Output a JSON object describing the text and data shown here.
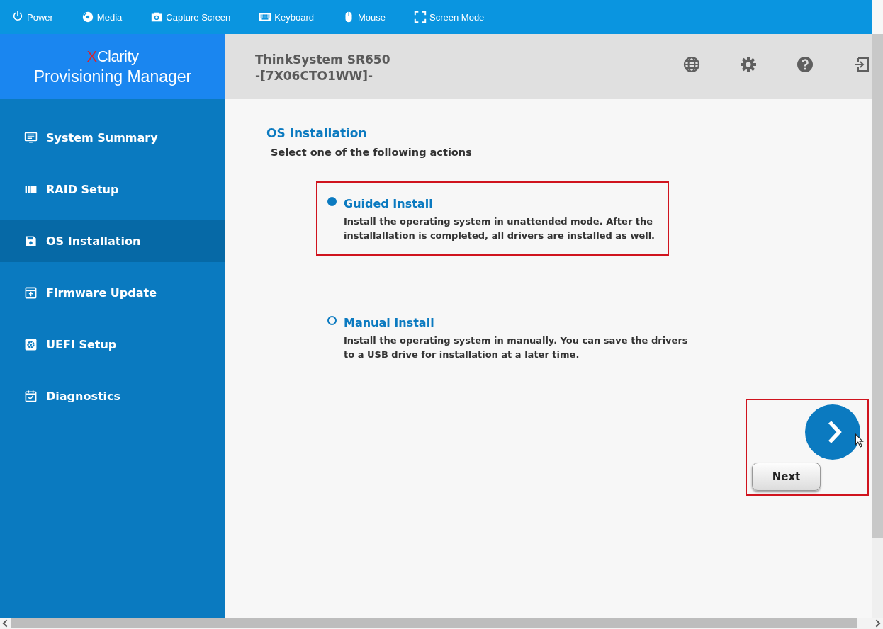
{
  "toolbar": [
    {
      "kind": "power",
      "label": "Power"
    },
    {
      "kind": "media",
      "label": "Media"
    },
    {
      "kind": "camera",
      "label": "Capture Screen"
    },
    {
      "kind": "keyboard",
      "label": "Keyboard"
    },
    {
      "kind": "mouse",
      "label": "Mouse"
    },
    {
      "kind": "screen",
      "label": "Screen Mode"
    }
  ],
  "logo": {
    "mark": "X",
    "name": "Clarity",
    "product": "Provisioning Manager"
  },
  "header": {
    "title_line_1": "ThinkSystem SR650",
    "title_line_2": "-[7X06CTO1WW]-",
    "icons": [
      {
        "kind": "globe"
      },
      {
        "kind": "settings"
      },
      {
        "kind": "help"
      },
      {
        "kind": "exit"
      }
    ]
  },
  "sidebar": {
    "items": [
      {
        "kind": "summary",
        "label": "System Summary",
        "selected": false
      },
      {
        "kind": "raid",
        "label": "RAID Setup",
        "selected": false
      },
      {
        "kind": "os",
        "label": "OS Installation",
        "selected": true
      },
      {
        "kind": "firmware",
        "label": "Firmware Update",
        "selected": false
      },
      {
        "kind": "uefi",
        "label": "UEFI Setup",
        "selected": false
      },
      {
        "kind": "diagnostics",
        "label": "Diagnostics",
        "selected": false
      }
    ]
  },
  "content": {
    "title": "OS Installation",
    "subtitle": "Select one of the following actions",
    "options": [
      {
        "title": "Guided Install",
        "description": "Install the operating system in unattended mode. After the installallation is completed, all drivers are installed as well.",
        "selected": true,
        "highlighted": true
      },
      {
        "title": "Manual Install",
        "description": "Install the operating system in manually. You can save the drivers to a USB drive for installation at a later time.",
        "selected": false,
        "highlighted": false
      }
    ],
    "next_button": {
      "label": "Next"
    }
  }
}
